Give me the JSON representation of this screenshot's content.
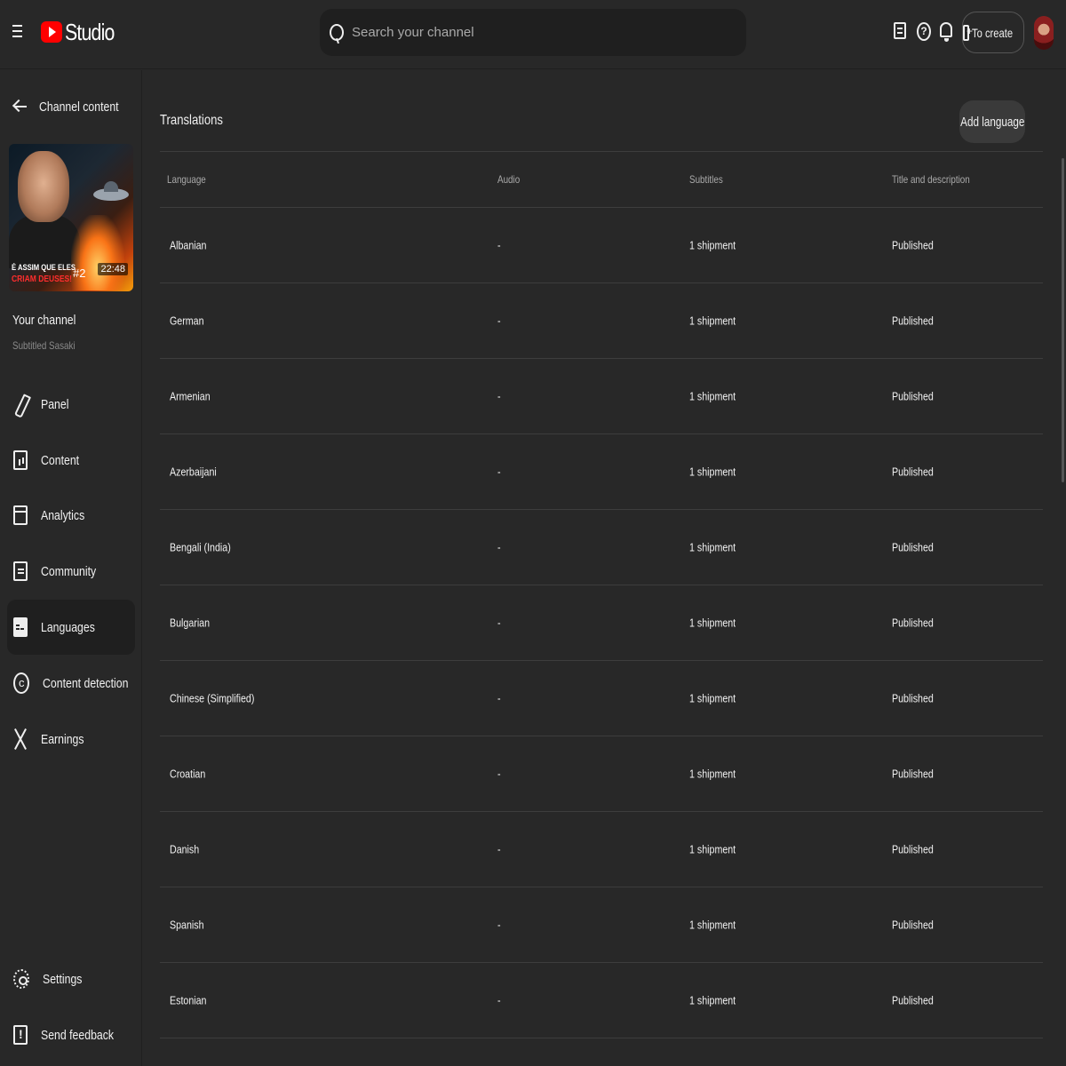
{
  "header": {
    "logo_text": "Studio",
    "search_placeholder": "Search your channel",
    "create_label": "To create"
  },
  "sidebar": {
    "back_label": "Channel content",
    "thumbnail": {
      "caption_line1": "É ASSIM QUE ELES",
      "caption_line2": "CRIAM DEUSES!",
      "badge_number": "#2",
      "duration": "22:48"
    },
    "channel_title": "Your channel",
    "channel_subtitle": "Subtitled Sasaki",
    "items": [
      {
        "label": "Panel",
        "icon": "pencil-icon"
      },
      {
        "label": "Content",
        "icon": "content-icon"
      },
      {
        "label": "Analytics",
        "icon": "analytics-icon"
      },
      {
        "label": "Community",
        "icon": "community-icon"
      },
      {
        "label": "Languages",
        "icon": "languages-icon",
        "active": true
      },
      {
        "label": "Content detection",
        "icon": "copyright-icon"
      },
      {
        "label": "Earnings",
        "icon": "scissors-icon"
      }
    ],
    "bottom_items": [
      {
        "label": "Settings",
        "icon": "gear-icon"
      },
      {
        "label": "Send feedback",
        "icon": "feedback-icon"
      }
    ]
  },
  "main": {
    "title": "Translations",
    "add_language_label": "Add language",
    "columns": [
      "Language",
      "Audio",
      "Subtitles",
      "Title and description"
    ],
    "rows": [
      {
        "language": "Albanian",
        "audio": "-",
        "subtitles": "1 shipment",
        "title_desc": "Published"
      },
      {
        "language": "German",
        "audio": "-",
        "subtitles": "1 shipment",
        "title_desc": "Published"
      },
      {
        "language": "Armenian",
        "audio": "-",
        "subtitles": "1 shipment",
        "title_desc": "Published"
      },
      {
        "language": "Azerbaijani",
        "audio": "-",
        "subtitles": "1 shipment",
        "title_desc": "Published"
      },
      {
        "language": "Bengali (India)",
        "audio": "-",
        "subtitles": "1 shipment",
        "title_desc": "Published"
      },
      {
        "language": "Bulgarian",
        "audio": "-",
        "subtitles": "1 shipment",
        "title_desc": "Published"
      },
      {
        "language": "Chinese (Simplified)",
        "audio": "-",
        "subtitles": "1 shipment",
        "title_desc": "Published"
      },
      {
        "language": "Croatian",
        "audio": "-",
        "subtitles": "1 shipment",
        "title_desc": "Published"
      },
      {
        "language": "Danish",
        "audio": "-",
        "subtitles": "1 shipment",
        "title_desc": "Published"
      },
      {
        "language": "Spanish",
        "audio": "-",
        "subtitles": "1 shipment",
        "title_desc": "Published"
      },
      {
        "language": "Estonian",
        "audio": "-",
        "subtitles": "1 shipment",
        "title_desc": "Published"
      }
    ]
  },
  "colors": {
    "background": "#282828",
    "active_nav": "#1f1f1f",
    "brand_red": "#ff0000",
    "divider": "#3d3d3d"
  }
}
